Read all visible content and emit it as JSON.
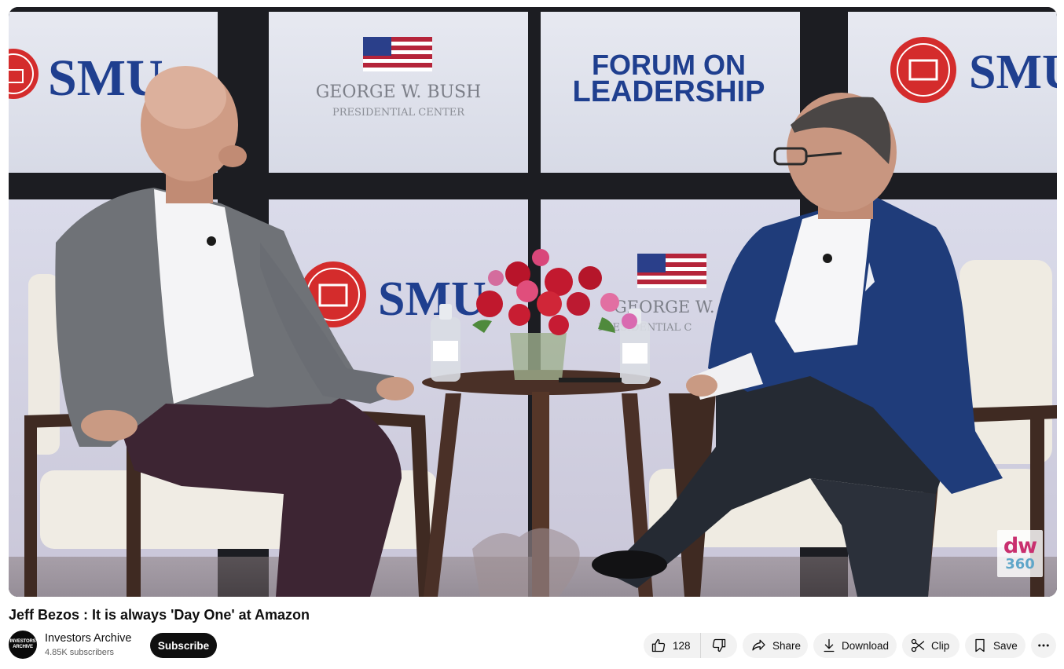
{
  "video": {
    "frame_text": {
      "smu": "SMU",
      "gwb_line1": "GEORGE W. BUSH",
      "gwb_line2": "PRESIDENTIAL CENTER",
      "forum_line1": "FORUM ON",
      "forum_line2": "LEADERSHIP",
      "gwb_partial_line1": "GEORGE W. BU",
      "gwb_partial_line2": "PRESIDENTIAL C"
    },
    "watermark": {
      "line1": "dw",
      "line2": "360"
    }
  },
  "title": "Jeff Bezos : It is always 'Day One' at Amazon",
  "channel": {
    "avatar_line1": "INVESTORS",
    "avatar_line2": "ARCHIVE",
    "name": "Investors Archive",
    "subscribers": "4.85K subscribers",
    "subscribe_label": "Subscribe"
  },
  "actions": {
    "like_count": "128",
    "share_label": "Share",
    "download_label": "Download",
    "clip_label": "Clip",
    "save_label": "Save"
  },
  "icons": [
    "thumbs-up-icon",
    "thumbs-down-icon",
    "share-icon",
    "download-icon",
    "scissors-icon",
    "bookmark-icon",
    "more-icon"
  ],
  "colors": {
    "smu_red": "#d42c2c",
    "smu_blue": "#1f3f8f",
    "subscribe_bg": "#0f0f0f",
    "pill_bg": "#f2f2f2"
  }
}
